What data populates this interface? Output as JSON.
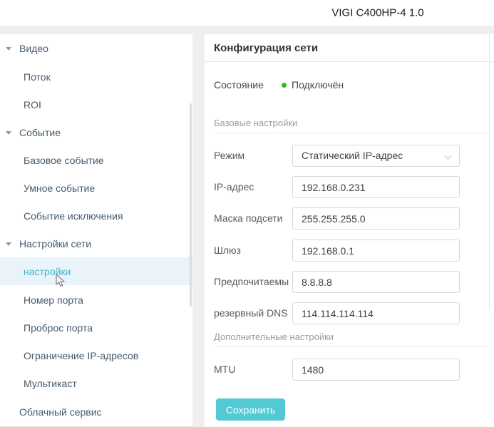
{
  "header": {
    "title": "VIGI C400HP-4 1.0"
  },
  "sidebar": {
    "items": [
      {
        "label": "Видео"
      },
      {
        "label": "Поток"
      },
      {
        "label": "ROI"
      },
      {
        "label": "Событие"
      },
      {
        "label": "Базовое событие"
      },
      {
        "label": "Умное событие"
      },
      {
        "label": "Событие исключения"
      },
      {
        "label": "Настройки сети"
      },
      {
        "label": "настройки"
      },
      {
        "label": "Номер порта"
      },
      {
        "label": "Проброс порта"
      },
      {
        "label": "Ограничение IP-адресов"
      },
      {
        "label": "Мультикаст"
      },
      {
        "label": "Облачный сервис"
      }
    ],
    "selected_item": "настройки"
  },
  "main": {
    "title": "Конфигурация сети",
    "status": {
      "label": "Состояние",
      "value": "Подключён",
      "dot_color": "#22c122"
    },
    "sections": {
      "basic": "Базовые настройки",
      "advanced": "Дополнительные настройки"
    },
    "fields": {
      "mode": {
        "label": "Режим",
        "value": "Статический IP-адрес"
      },
      "ip": {
        "label": "IP-адрес",
        "value": "192.168.0.231"
      },
      "mask": {
        "label": "Маска подсети",
        "value": "255.255.255.0"
      },
      "gateway": {
        "label": "Шлюз",
        "value": "192.168.0.1"
      },
      "dns_primary": {
        "label": "Предпочитаемы",
        "value": "8.8.8.8"
      },
      "dns_backup": {
        "label": "резервный DNS",
        "value": "114.114.114.114"
      },
      "mtu": {
        "label": "MTU",
        "value": "1480"
      }
    },
    "save_button": "Сохранить"
  },
  "colors": {
    "accent_teal": "#53c9d4",
    "selected_text": "#45b5c6",
    "selected_bg": "#e8f4fa",
    "status_green": "#22c122"
  }
}
